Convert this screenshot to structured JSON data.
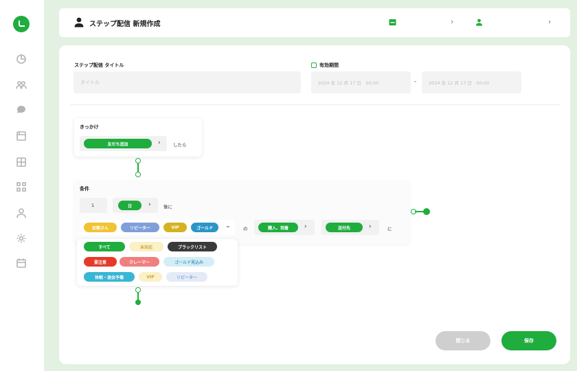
{
  "sidebar": {
    "icons": [
      "dashboard-icon",
      "users-icon",
      "chat-icon",
      "media-icon",
      "table-icon",
      "grid-icon",
      "person-icon",
      "gear-icon",
      "calendar-icon"
    ]
  },
  "header": {
    "title": "ステップ配信 新規作成",
    "chev1": "›",
    "chev2": "›"
  },
  "form": {
    "title_label": "ステップ配信 タイトル",
    "title_placeholder": "タイトル",
    "period_label": "有効期間",
    "start_date": "2024 年 12 月 17 日　00:00",
    "end_date": "2024 年 12 月 17 日　00:00",
    "range_dash": "-"
  },
  "trigger": {
    "label": "きっかけ",
    "pill": "友だち追加",
    "chev": "›",
    "suffix": "したら"
  },
  "condition": {
    "label": "条件",
    "count": "1",
    "unit_pill": "日",
    "chev": "›",
    "after": "後に",
    "tags": [
      "初期さん",
      "リピーター",
      "VIP",
      "ゴールド"
    ],
    "dropdown_chev": "⌄",
    "connector": "の",
    "pill_a": "購入、到着",
    "pill_b": "送付先",
    "suffix": "に",
    "options": [
      [
        "すべて",
        "未対応",
        "ブラックリスト"
      ],
      [
        "要注意",
        "クレーマー",
        "ゴールド見込み"
      ],
      [
        "休眠・退会予備",
        "VIP",
        "リピーター"
      ]
    ]
  },
  "actions": {
    "cancel": "閉じる",
    "save": "保存"
  },
  "colors": {
    "brand": "#1fad3e",
    "background": "#e2f1e1"
  }
}
